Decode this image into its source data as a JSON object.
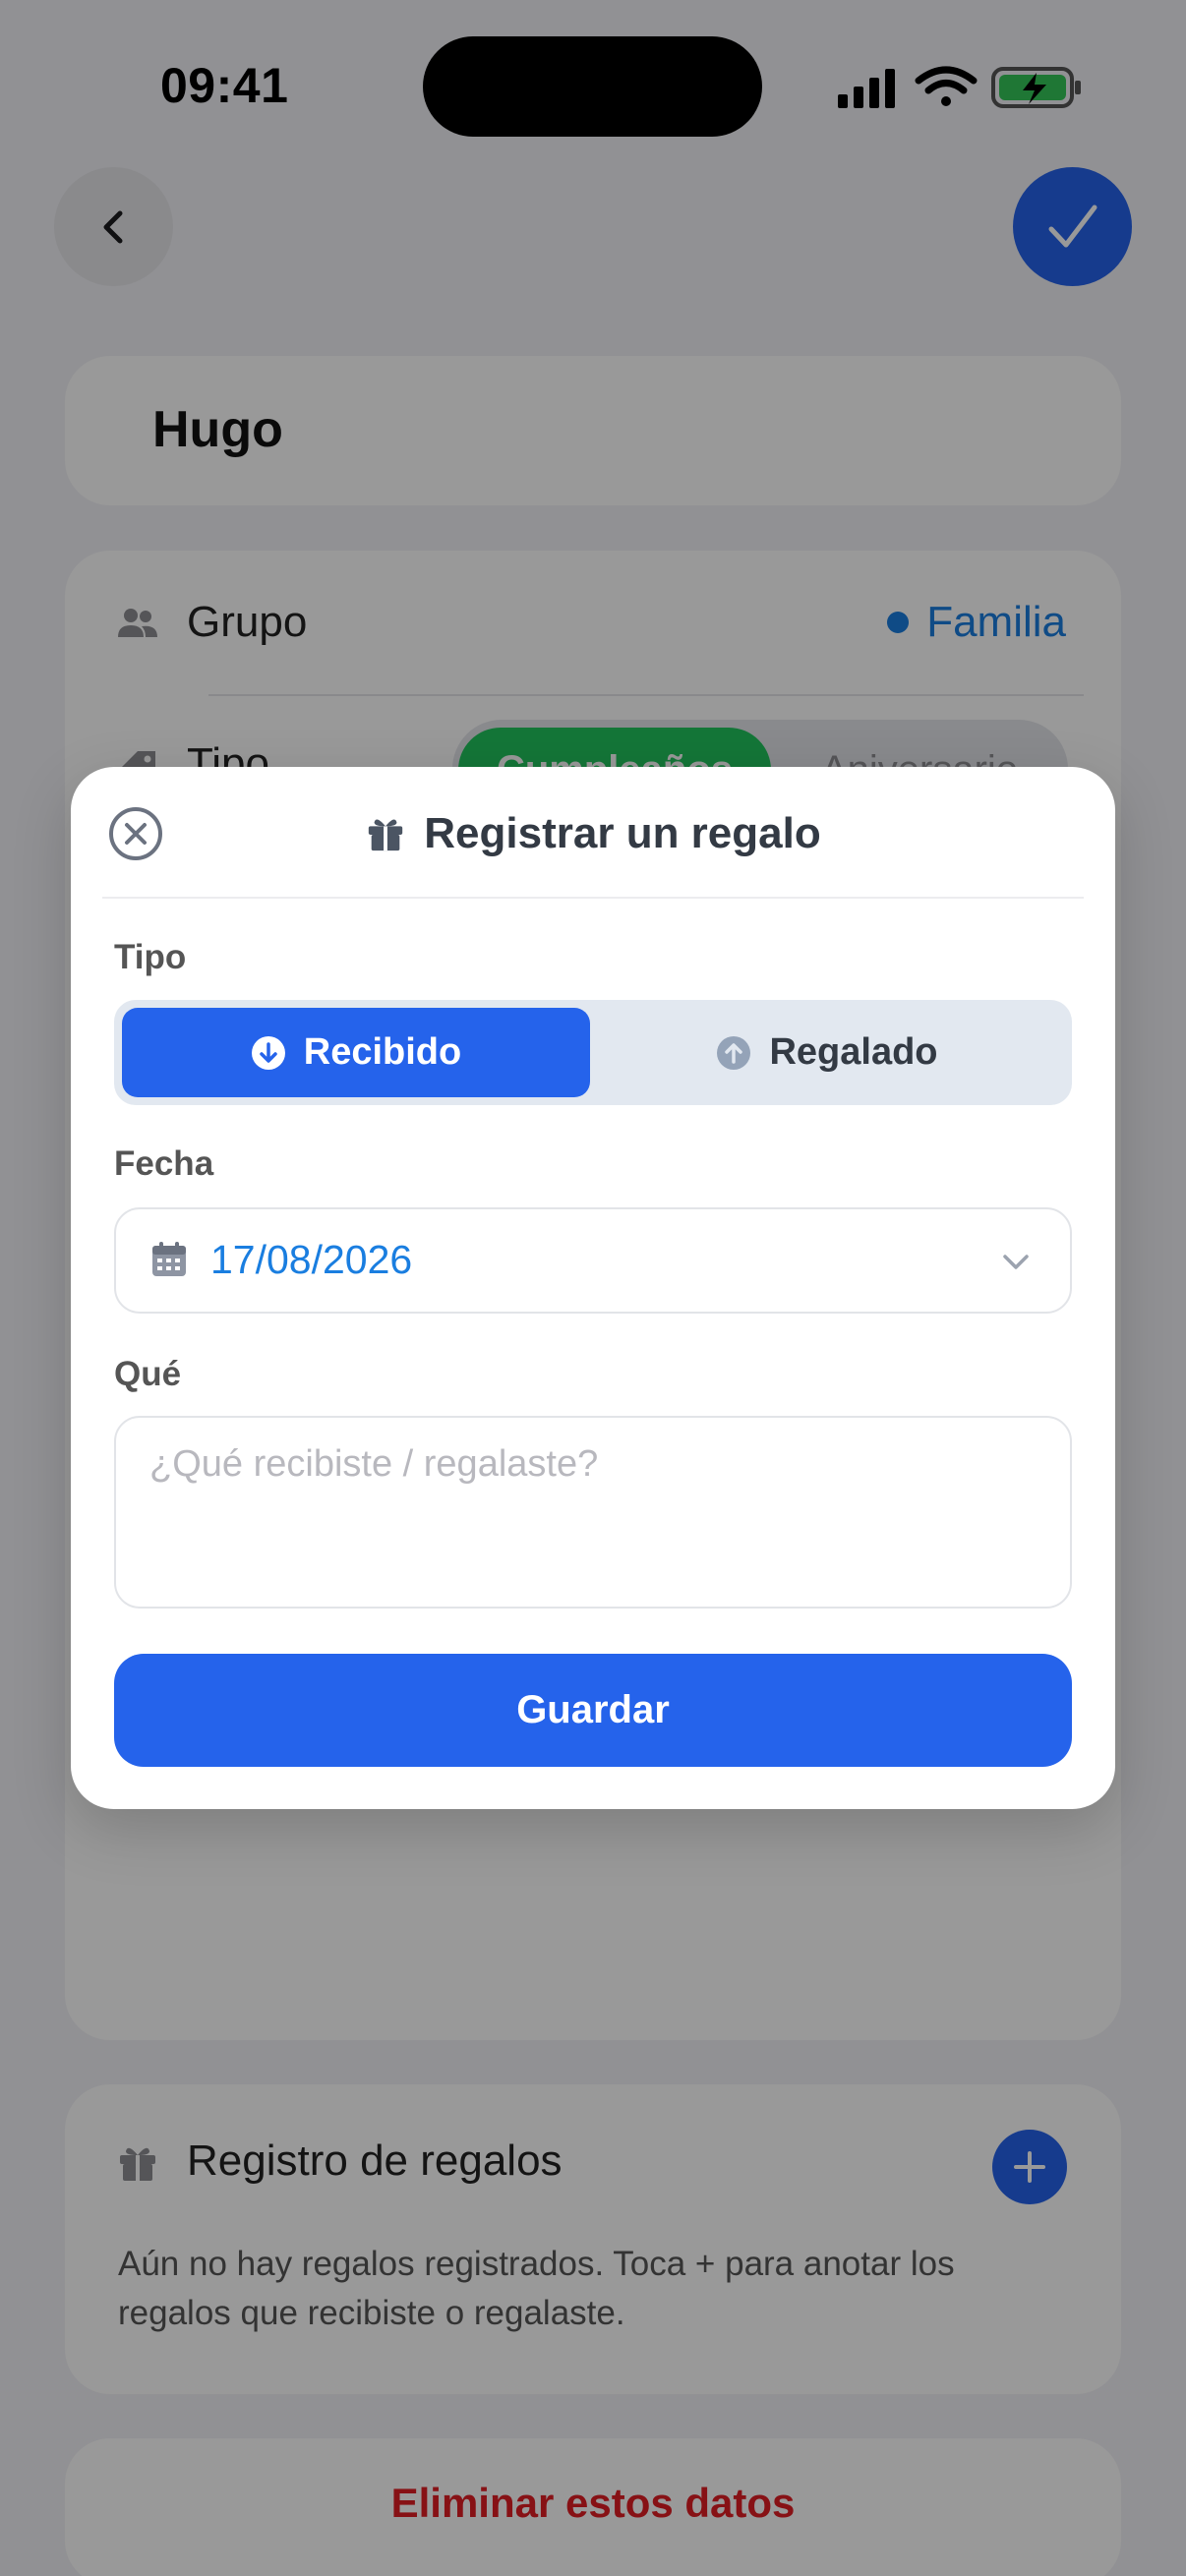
{
  "status_bar": {
    "time": "09:41"
  },
  "contact": {
    "name": "Hugo"
  },
  "info": {
    "group_label": "Grupo",
    "group_value": "Familia",
    "type_label": "Tipo",
    "type_options": [
      "Cumpleaños",
      "Aniversario"
    ]
  },
  "gifts_section": {
    "title": "Registro de regalos",
    "empty_text": "Aún no hay regalos registrados. Toca + para anotar los regalos que recibiste o regalaste."
  },
  "delete_label": "Eliminar estos datos",
  "modal": {
    "title": "Registrar un regalo",
    "type_label": "Tipo",
    "type_received": "Recibido",
    "type_given": "Regalado",
    "date_label": "Fecha",
    "date_value": "17/08/2026",
    "what_label": "Qué",
    "what_placeholder": "¿Qué recibiste / regalaste?",
    "save_label": "Guardar"
  },
  "colors": {
    "accent": "#2563eb",
    "link": "#1a7ee0",
    "success": "#22c55e",
    "danger": "#e11d24"
  },
  "icons": [
    "back-chevron-icon",
    "checkmark-icon",
    "people-icon",
    "tag-icon",
    "gift-icon",
    "plus-icon",
    "close-circle-icon",
    "arrow-down-circle-icon",
    "arrow-up-circle-icon",
    "calendar-icon",
    "chevron-down-icon"
  ]
}
